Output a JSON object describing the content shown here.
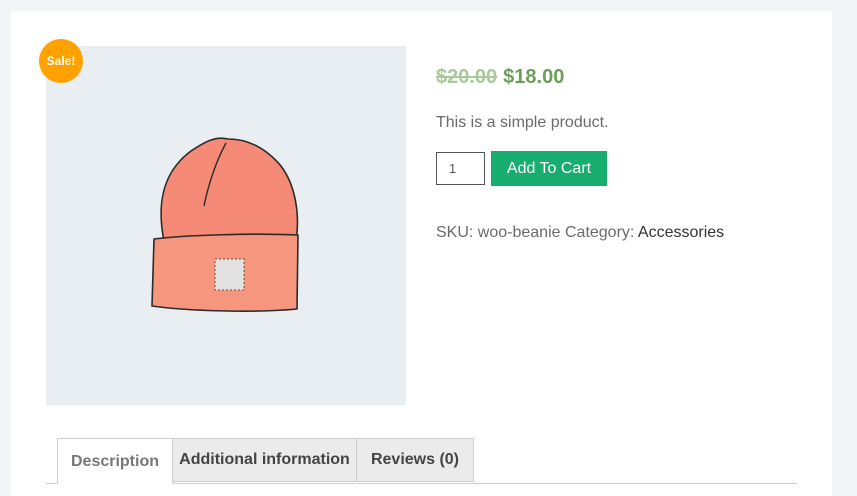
{
  "product": {
    "sale_badge": "Sale!",
    "price_old": "$20.00",
    "price_new": "$18.00",
    "short_description": "This is a simple product.",
    "quantity": "1",
    "add_to_cart_label": "Add To Cart",
    "sku_label": "SKU:",
    "sku_value": "woo-beanie",
    "category_label": "Category:",
    "category_value": "Accessories"
  },
  "tabs": [
    {
      "label": "Description",
      "active": true
    },
    {
      "label": "Additional information",
      "active": false
    },
    {
      "label": "Reviews (0)",
      "active": false
    }
  ],
  "colors": {
    "sale_badge": "#ffa200",
    "price_old": "#a8c99b",
    "price_new": "#6e9e5a",
    "add_to_cart": "#17ad6f",
    "beanie": "#f58a76"
  }
}
